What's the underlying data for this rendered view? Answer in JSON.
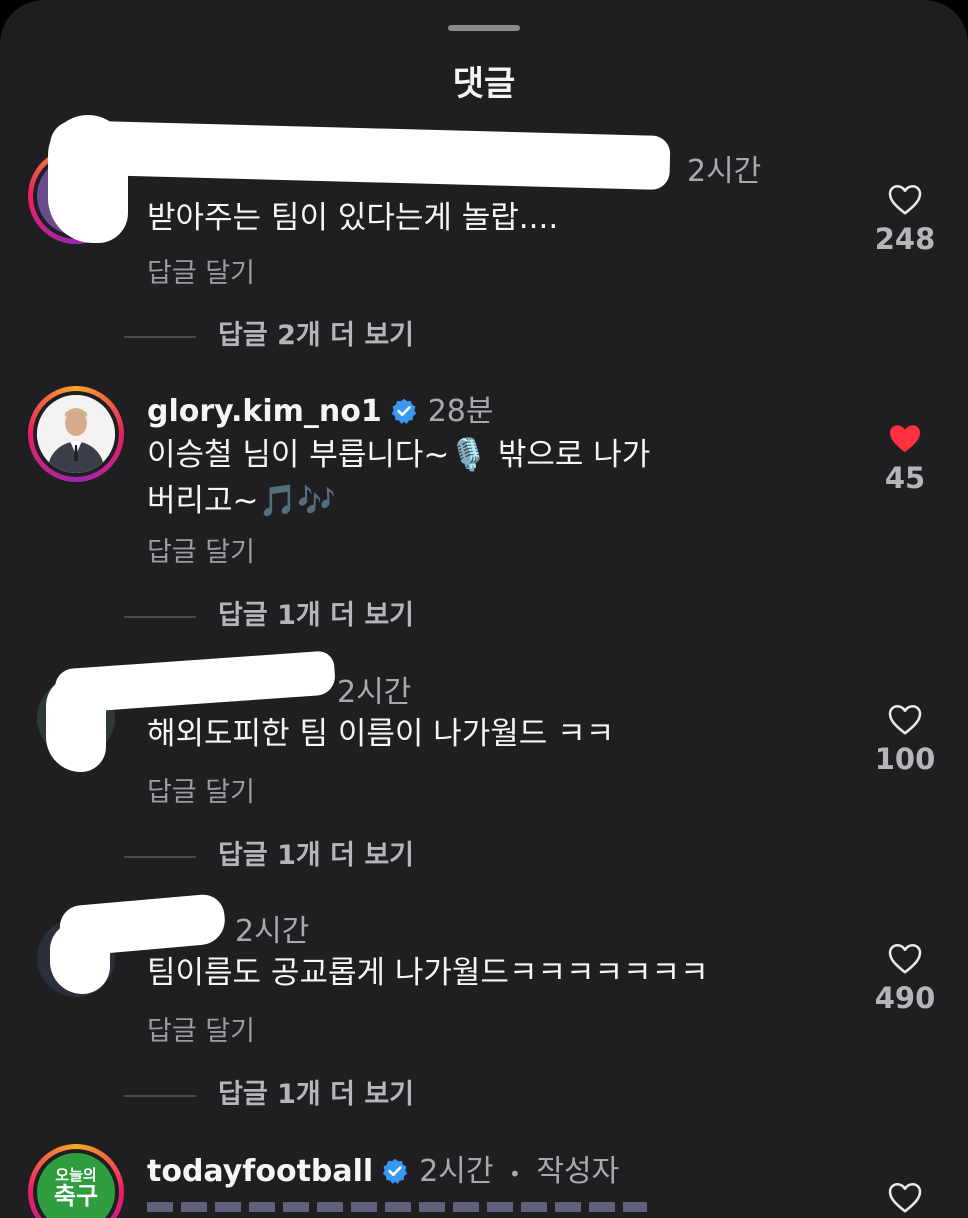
{
  "sheet": {
    "title": "댓글"
  },
  "comments": [
    {
      "time": "2시간",
      "text": "받아주는 팀이 있다는게 놀랍....",
      "reply_label": "답글 달기",
      "more_replies": "답글 2개 더 보기",
      "likes": "248",
      "liked": false,
      "redacted": true
    },
    {
      "username": "glory.kim_no1",
      "verified": true,
      "time": "28분",
      "text_line1": "이승철 님이 부릅니다~🎙️ 밖으로 나가",
      "text_line2": "버리고~🎵🎶",
      "reply_label": "답글 달기",
      "more_replies": "답글 1개 더 보기",
      "likes": "45",
      "liked": true
    },
    {
      "time": "2시간",
      "text": "해외도피한 팀 이름이 나가월드 ㅋㅋ",
      "reply_label": "답글 달기",
      "more_replies": "답글 1개 더 보기",
      "likes": "100",
      "liked": false,
      "redacted": true
    },
    {
      "time": "2시간",
      "text": "팀이름도 공교롭게 나가월드ㅋㅋㅋㅋㅋㅋㅋ",
      "reply_label": "답글 달기",
      "more_replies": "답글 1개 더 보기",
      "likes": "490",
      "liked": false,
      "redacted": true
    },
    {
      "username": "todayfootball",
      "verified": true,
      "time": "2시간",
      "separator": "•",
      "author_tag": "작성자",
      "avatar_text_top": "오늘의",
      "avatar_text_bottom": "축구",
      "liked": false
    }
  ],
  "colors": {
    "background": "#1f1f22",
    "liked_heart": "#ff3040",
    "verified_badge": "#3897f0"
  },
  "icons": {
    "like": "heart-icon",
    "liked": "heart-filled-icon",
    "verified": "verified-badge-icon"
  }
}
